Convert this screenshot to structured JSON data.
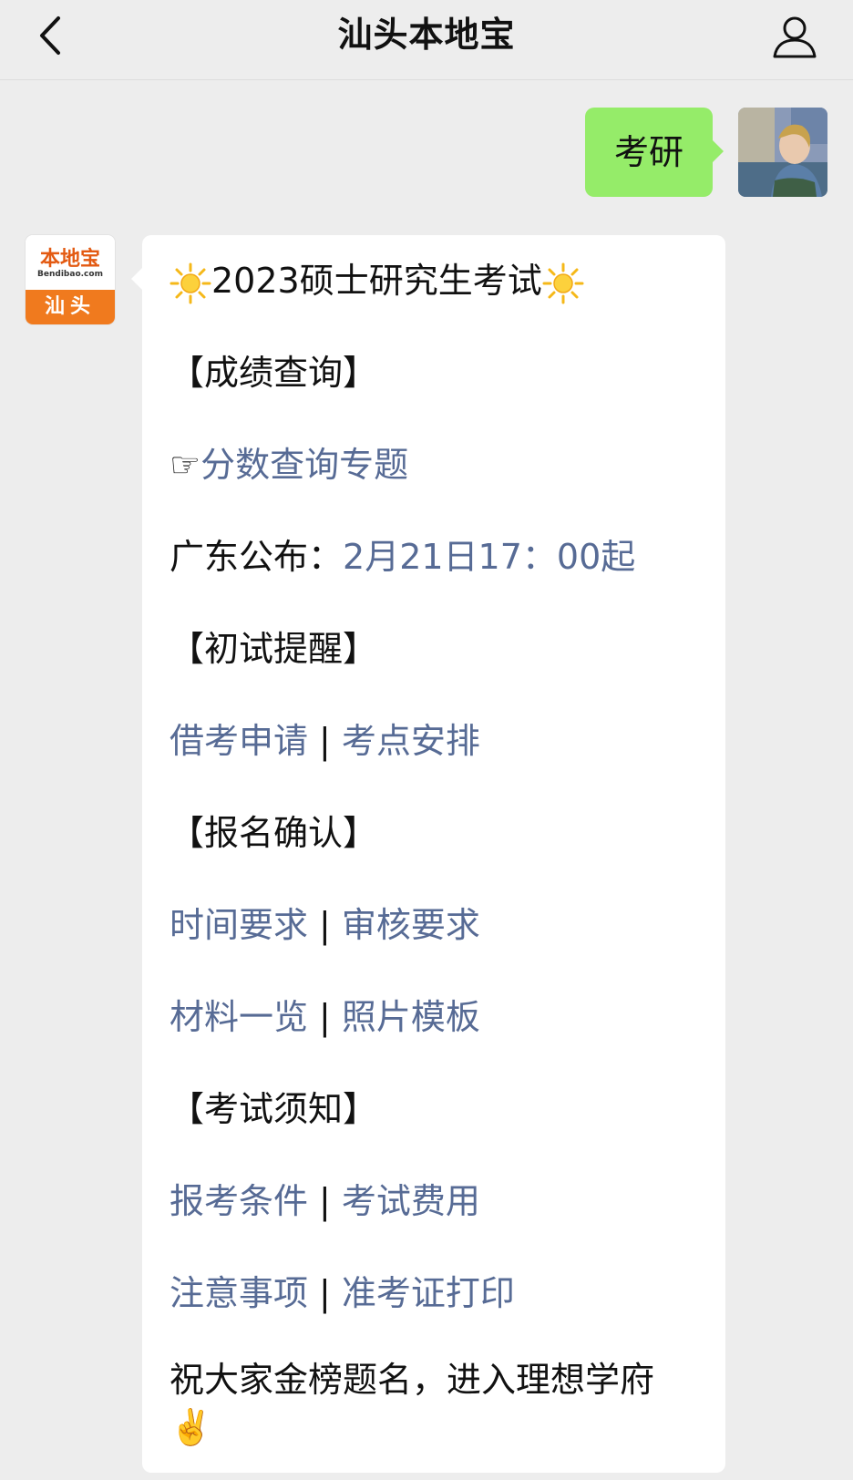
{
  "nav": {
    "title": "汕头本地宝"
  },
  "sent": {
    "text": "考研"
  },
  "brand": {
    "logo": "本地宝",
    "url": "Bendibao.com",
    "city": "汕头"
  },
  "reply": {
    "title": "2023硕士研究生考试",
    "section_score": "【成绩查询】",
    "pointer": "☞",
    "score_link": "分数查询专题",
    "publish_label": "广东公布：",
    "publish_time": "2月21日17：00起",
    "section_initial": "【初试提醒】",
    "link_borrow": "借考申请",
    "link_site": "考点安排",
    "section_confirm": "【报名确认】",
    "link_time": "时间要求",
    "link_review": "审核要求",
    "link_materials": "材料一览",
    "link_photo": "照片模板",
    "section_notice": "【考试须知】",
    "link_conditions": "报考条件",
    "link_fees": "考试费用",
    "link_matters": "注意事项",
    "link_admission": "准考证打印",
    "separator": "|",
    "closing": "祝大家金榜题名，进入理想学府",
    "victory_emoji": "✌️"
  },
  "icons": {
    "back": "chevron-left-icon",
    "user": "user-icon",
    "sun": "sun-icon"
  },
  "colors": {
    "link": "#576b95",
    "sent_bubble": "#95ec69",
    "brand_orange": "#f07a1e"
  }
}
